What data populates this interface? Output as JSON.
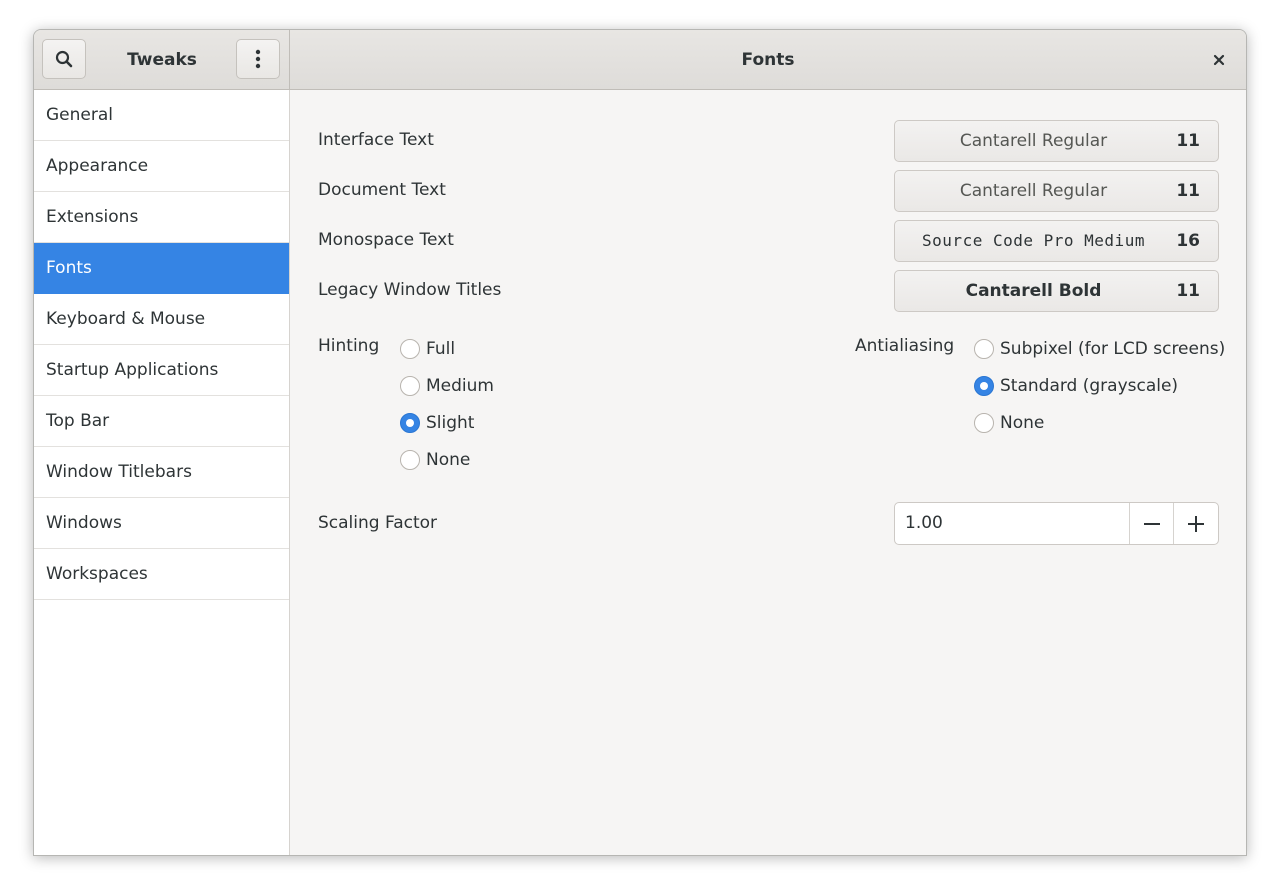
{
  "header": {
    "app_title": "Tweaks",
    "page_title": "Fonts",
    "icons": {
      "search": "search-icon",
      "menu": "vertical-dots-menu-icon",
      "close": "close-icon"
    }
  },
  "sidebar": {
    "items": [
      {
        "label": "General"
      },
      {
        "label": "Appearance"
      },
      {
        "label": "Extensions"
      },
      {
        "label": "Fonts",
        "selected": true
      },
      {
        "label": "Keyboard & Mouse"
      },
      {
        "label": "Startup Applications"
      },
      {
        "label": "Top Bar"
      },
      {
        "label": "Window Titlebars"
      },
      {
        "label": "Windows"
      },
      {
        "label": "Workspaces"
      }
    ]
  },
  "fonts": {
    "interface": {
      "label": "Interface Text",
      "font": "Cantarell Regular",
      "size": "11"
    },
    "document": {
      "label": "Document Text",
      "font": "Cantarell Regular",
      "size": "11"
    },
    "monospace": {
      "label": "Monospace Text",
      "font": "Source Code Pro Medium",
      "size": "16"
    },
    "legacy": {
      "label": "Legacy Window Titles",
      "font": "Cantarell Bold",
      "size": "11"
    }
  },
  "hinting": {
    "label": "Hinting",
    "options": [
      "Full",
      "Medium",
      "Slight",
      "None"
    ],
    "selected": "Slight"
  },
  "antialiasing": {
    "label": "Antialiasing",
    "options": [
      "Subpixel (for LCD screens)",
      "Standard (grayscale)",
      "None"
    ],
    "selected": "Standard (grayscale)"
  },
  "scaling": {
    "label": "Scaling Factor",
    "value": "1.00"
  },
  "colors": {
    "accent": "#3584e4",
    "text": "#2e3436",
    "window_bg": "#f6f5f4"
  }
}
